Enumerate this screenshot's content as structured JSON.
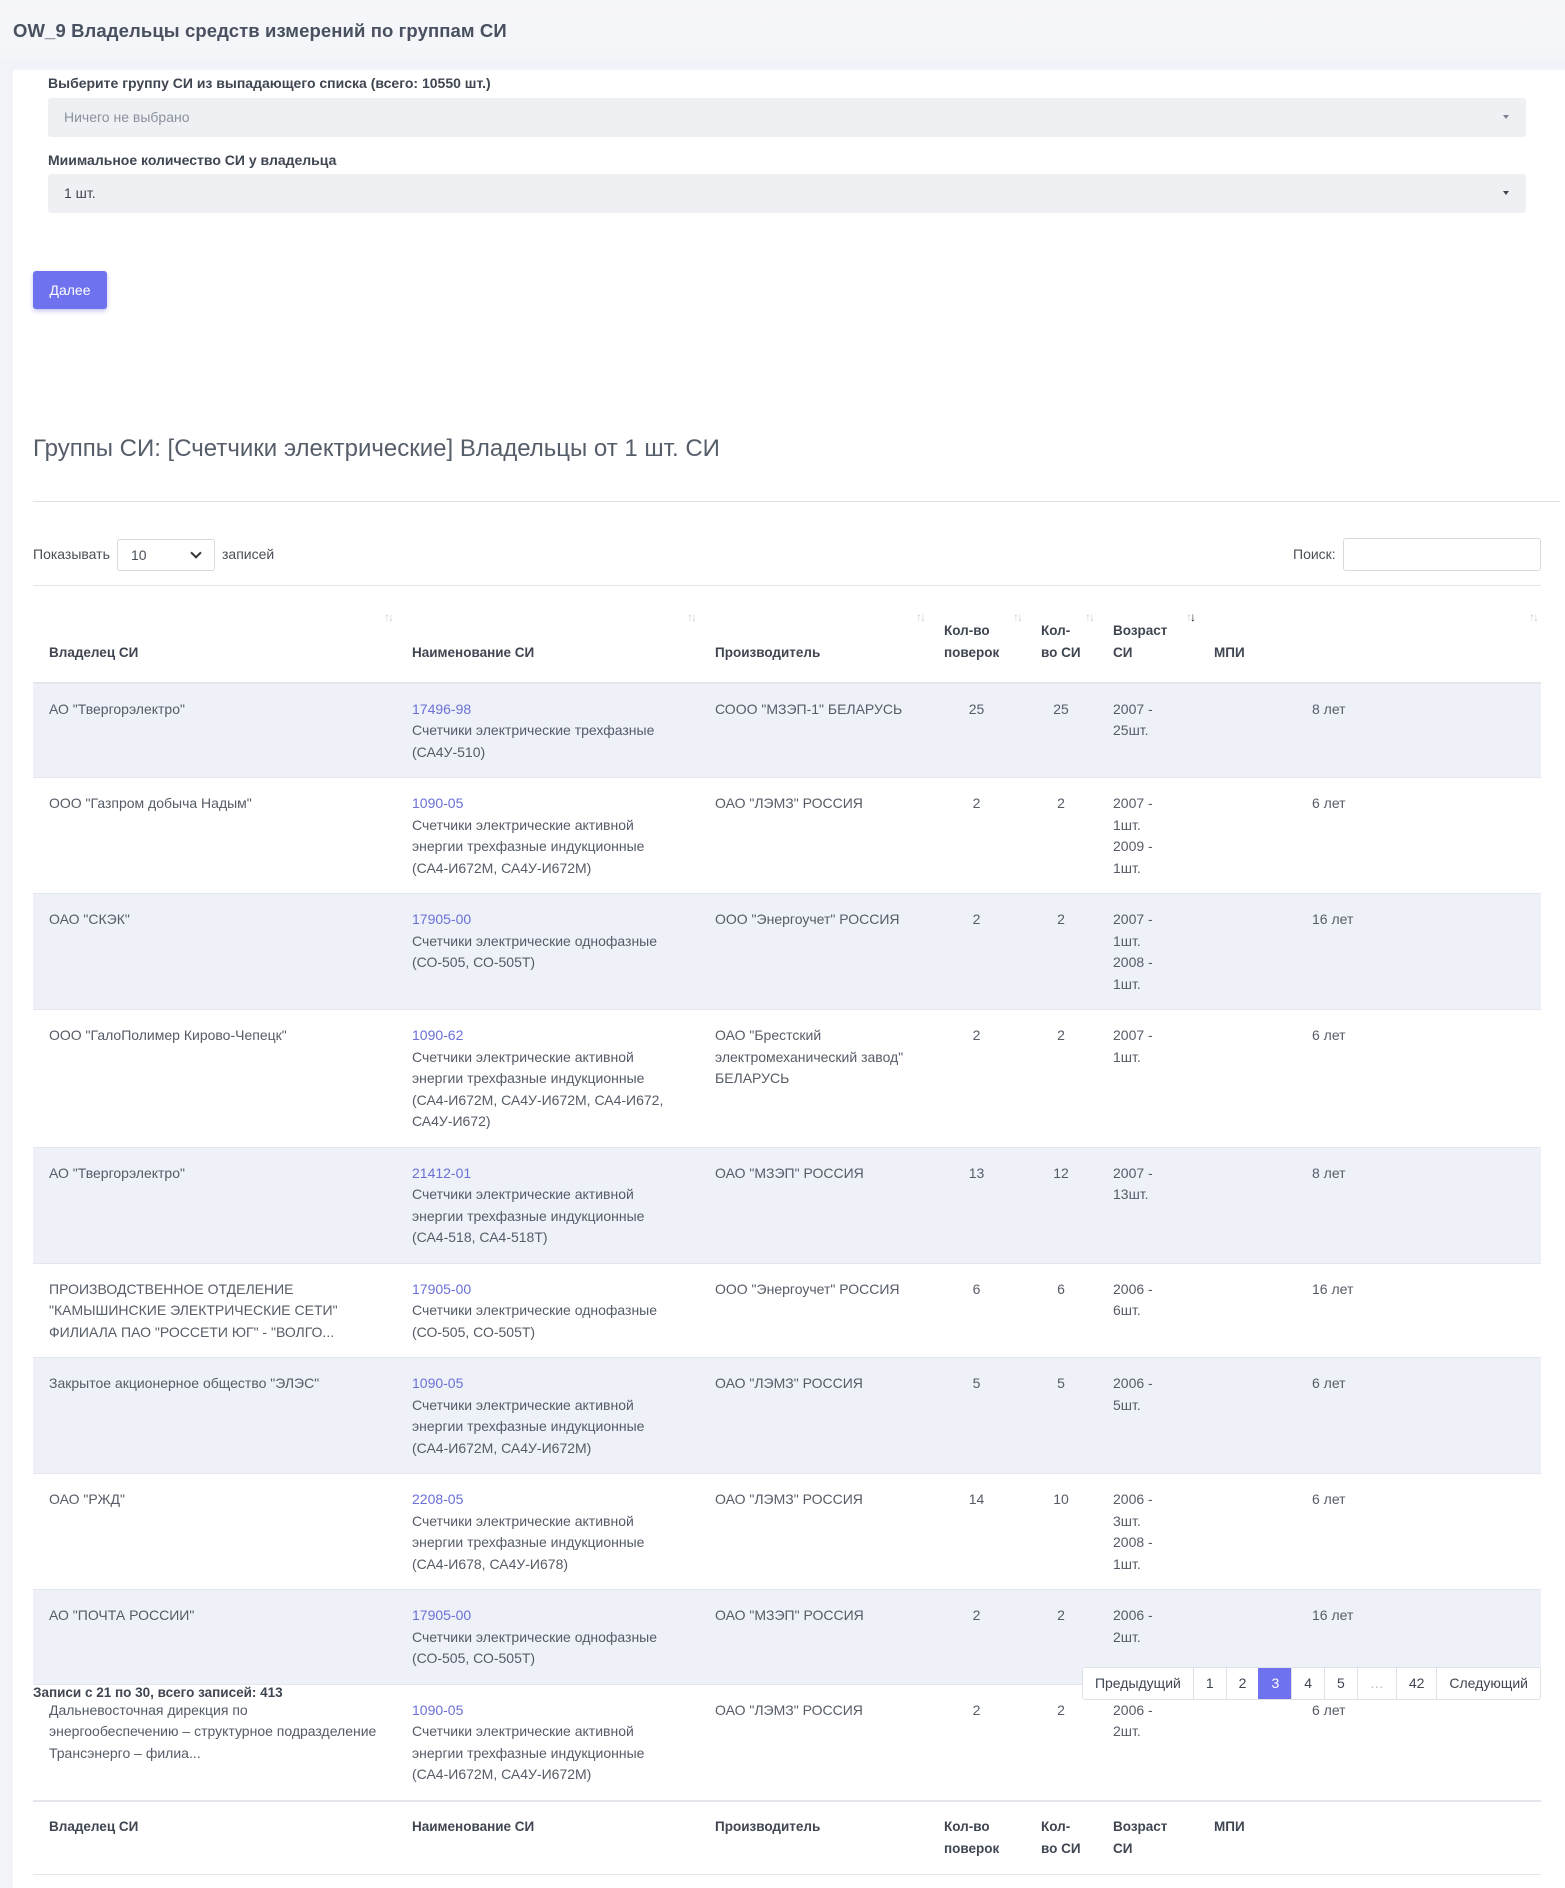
{
  "page": {
    "title": "OW_9 Владельцы средств измерений по группам СИ"
  },
  "form": {
    "group_label": "Выберите группу СИ из выпадающего списка (всего: 10550 шт.)",
    "group_value": "Ничего не выбрано",
    "min_label": "Миимальное количество СИ у владельца",
    "min_value": "1 шт.",
    "next_button": "Далее"
  },
  "section": {
    "title": "Группы СИ: [Счетчики электрические] Владельцы от 1 шт. СИ"
  },
  "length": {
    "prefix": "Показывать",
    "value": "10",
    "suffix": "записей"
  },
  "search": {
    "label": "Поиск:"
  },
  "table": {
    "headers": {
      "owner": "Владелец СИ",
      "name": "Наименование СИ",
      "maker": "Производитель",
      "verifications": "Кол-во поверок",
      "count": "Кол-во СИ",
      "age": "Возраст СИ",
      "mpi": "МПИ"
    },
    "rows": [
      {
        "owner": "АО \"Твергорэлектро\"",
        "code": "17496-98",
        "name": "Счетчики электрические трехфазные (СА4У-510)",
        "maker": "СООО \"МЗЭП-1\" БЕЛАРУСЬ",
        "verifications": "25",
        "count": "25",
        "age": [
          "2007 - 25шт."
        ],
        "mpi": "8 лет"
      },
      {
        "owner": "ООО \"Газпром добыча Надым\"",
        "code": "1090-05",
        "name": "Счетчики электрические активной энергии трехфазные индукционные (СА4-И672М, СА4У-И672М)",
        "maker": "ОАО \"ЛЭМЗ\" РОССИЯ",
        "verifications": "2",
        "count": "2",
        "age": [
          "2007 - 1шт.",
          "2009 - 1шт."
        ],
        "mpi": "6 лет"
      },
      {
        "owner": "ОАО \"СКЭК\"",
        "code": "17905-00",
        "name": "Счетчики электрические однофазные (СО-505, СО-505Т)",
        "maker": "ООО \"Энергоучет\" РОССИЯ",
        "verifications": "2",
        "count": "2",
        "age": [
          "2007 - 1шт.",
          "2008 - 1шт."
        ],
        "mpi": "16 лет"
      },
      {
        "owner": "ООО \"ГалоПолимер Кирово-Чепецк\"",
        "code": "1090-62",
        "name": "Счетчики электрические активной энергии трехфазные индукционные (СА4-И672М, СА4У-И672М, СА4-И672, СА4У-И672)",
        "maker": "ОАО \"Брестский электромеханический завод\" БЕЛАРУСЬ",
        "verifications": "2",
        "count": "2",
        "age": [
          "2007 - 1шт."
        ],
        "mpi": "6 лет"
      },
      {
        "owner": "АО \"Твергорэлектро\"",
        "code": "21412-01",
        "name": "Счетчики электрические активной энергии трехфазные индукционные (СА4-518, СА4-518Т)",
        "maker": "ОАО \"МЗЭП\" РОССИЯ",
        "verifications": "13",
        "count": "12",
        "age": [
          "2007 - 13шт."
        ],
        "mpi": "8 лет"
      },
      {
        "owner": "ПРОИЗВОДСТВЕННОЕ ОТДЕЛЕНИЕ \"КАМЫШИНСКИЕ ЭЛЕКТРИЧЕСКИЕ СЕТИ\" ФИЛИАЛА ПАО \"РОССЕТИ ЮГ\" - \"ВОЛГО...",
        "code": "17905-00",
        "name": "Счетчики электрические однофазные (СО-505, СО-505Т)",
        "maker": "ООО \"Энергоучет\" РОССИЯ",
        "verifications": "6",
        "count": "6",
        "age": [
          "2006 - 6шт."
        ],
        "mpi": "16 лет"
      },
      {
        "owner": "Закрытое акционерное общество \"ЭЛЭС\"",
        "code": "1090-05",
        "name": "Счетчики электрические активной энергии трехфазные индукционные (СА4-И672М, СА4У-И672М)",
        "maker": "ОАО \"ЛЭМЗ\" РОССИЯ",
        "verifications": "5",
        "count": "5",
        "age": [
          "2006 - 5шт."
        ],
        "mpi": "6 лет"
      },
      {
        "owner": "ОАО \"РЖД\"",
        "code": "2208-05",
        "name": "Счетчики электрические активной энергии трехфазные индукционные (СА4-И678, СА4У-И678)",
        "maker": "ОАО \"ЛЭМЗ\" РОССИЯ",
        "verifications": "14",
        "count": "10",
        "age": [
          "2006 - 3шт.",
          "2008 - 1шт."
        ],
        "mpi": "6 лет"
      },
      {
        "owner": "АО \"ПОЧТА РОССИИ\"",
        "code": "17905-00",
        "name": "Счетчики электрические однофазные (СО-505, СО-505Т)",
        "maker": "ОАО \"МЗЭП\" РОССИЯ",
        "verifications": "2",
        "count": "2",
        "age": [
          "2006 - 2шт."
        ],
        "mpi": "16 лет"
      },
      {
        "owner": "Дальневосточная дирекция по энергообеспечению – структурное подразделение Трансэнерго – филиа...",
        "code": "1090-05",
        "name": "Счетчики электрические активной энергии трехфазные индукционные (СА4-И672М, СА4У-И672М)",
        "maker": "ОАО \"ЛЭМЗ\" РОССИЯ",
        "verifications": "2",
        "count": "2",
        "age": [
          "2006 - 2шт."
        ],
        "mpi": "6 лет"
      }
    ]
  },
  "info": "Записи с 21 по 30, всего записей: 413",
  "pagination": {
    "prev": "Предыдущий",
    "pages": [
      "1",
      "2",
      "3",
      "4",
      "5",
      "…",
      "42"
    ],
    "active": "3",
    "next": "Следующий"
  }
}
